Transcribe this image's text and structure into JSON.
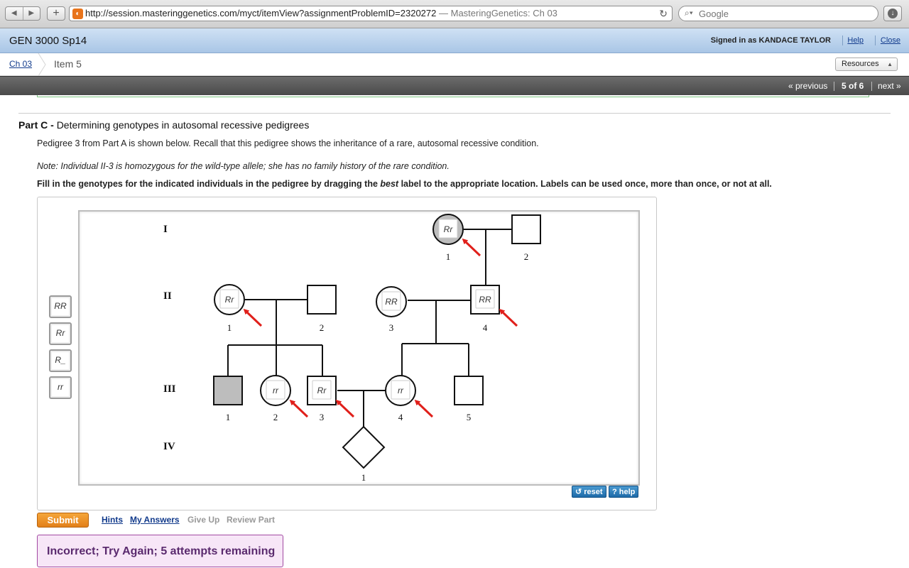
{
  "browser": {
    "url": "http://session.masteringgenetics.com/myct/itemView?assignmentProblemID=2320272",
    "page_title": "— MasteringGenetics: Ch 03",
    "search_placeholder": "Google"
  },
  "header": {
    "course": "GEN 3000 Sp14",
    "signed_in": "Signed in as KANDACE TAYLOR",
    "help": "Help",
    "close": "Close"
  },
  "breadcrumb": {
    "chapter": "Ch 03",
    "item": "Item 5",
    "resources": "Resources"
  },
  "navigation": {
    "previous": "« previous",
    "count": "5 of 6",
    "next": "next »"
  },
  "question": {
    "part_label": "Part C -",
    "part_title": "Determining genotypes in autosomal recessive pedigrees",
    "text_1": "Pedigree 3 from Part A is shown below. Recall that this pedigree shows the inheritance of a rare, autosomal recessive condition.",
    "note": "Note: Individual II-3 is homozygous for the wild-type allele; she has no family history of the rare condition.",
    "instruction_pre": "Fill in the genotypes for the indicated individuals in the pedigree by dragging the ",
    "instruction_em": "best",
    "instruction_post": " label to the appropriate location. Labels can be used once, more than once, or not at all."
  },
  "label_bank": [
    "RR",
    "Rr",
    "R_",
    "rr"
  ],
  "pedigree": {
    "generations": [
      "I",
      "II",
      "III",
      "IV"
    ],
    "individuals": [
      {
        "id": "I-1",
        "number": "1",
        "sex": "female",
        "affected": true,
        "genotype": "Rr"
      },
      {
        "id": "I-2",
        "number": "2",
        "sex": "male",
        "affected": false,
        "genotype": ""
      },
      {
        "id": "II-1",
        "number": "1",
        "sex": "female",
        "affected": false,
        "genotype": "Rr"
      },
      {
        "id": "II-2",
        "number": "2",
        "sex": "male",
        "affected": false,
        "genotype": ""
      },
      {
        "id": "II-3",
        "number": "3",
        "sex": "female",
        "affected": false,
        "genotype": "RR"
      },
      {
        "id": "II-4",
        "number": "4",
        "sex": "male",
        "affected": false,
        "genotype": "RR"
      },
      {
        "id": "III-1",
        "number": "1",
        "sex": "male",
        "affected": true,
        "genotype": ""
      },
      {
        "id": "III-2",
        "number": "2",
        "sex": "female",
        "affected": false,
        "genotype": "rr"
      },
      {
        "id": "III-3",
        "number": "3",
        "sex": "male",
        "affected": false,
        "genotype": "Rr"
      },
      {
        "id": "III-4",
        "number": "4",
        "sex": "female",
        "affected": false,
        "genotype": "rr"
      },
      {
        "id": "III-5",
        "number": "5",
        "sex": "male",
        "affected": false,
        "genotype": ""
      },
      {
        "id": "IV-1",
        "number": "1",
        "sex": "unknown",
        "affected": false,
        "genotype": ""
      }
    ],
    "arrow_targets": [
      "I-1",
      "II-1",
      "II-4",
      "III-2",
      "III-3",
      "III-4"
    ]
  },
  "tools": {
    "reset": "reset",
    "help": "help"
  },
  "controls": {
    "submit": "Submit",
    "hints": "Hints",
    "my_answers": "My Answers",
    "give_up": "Give Up",
    "review_part": "Review Part"
  },
  "feedback": "Incorrect; Try Again; 5 attempts remaining",
  "colors": {
    "affected_fill": "#bdbdbd",
    "arrow": "#e0201b",
    "submit": "#ee921f",
    "feedback_bg": "#f7e6f7",
    "header_blue": "#bcd4ee"
  }
}
